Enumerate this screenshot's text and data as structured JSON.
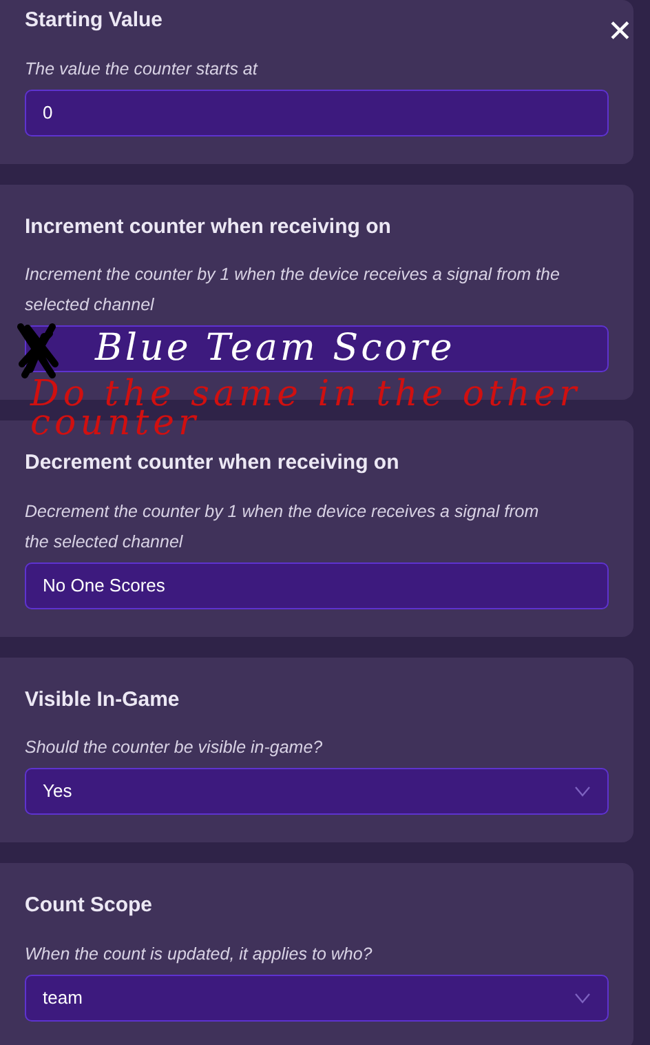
{
  "close_button": {
    "label": "✕"
  },
  "sections": [
    {
      "title": "Starting Value",
      "description": "The value the counter starts at",
      "field": {
        "kind": "text",
        "value": "0"
      }
    },
    {
      "title": "Increment counter when receiving on",
      "description": "Increment the counter by 1 when the device receives a signal from the selected channel",
      "field": {
        "kind": "text"
      },
      "annotation": {
        "text": "Blue Team Score",
        "color": "#ffffff"
      }
    },
    {
      "title": "Decrement counter when receiving on",
      "description": "Decrement the counter by 1 when the device receives a signal from the selected channel",
      "field": {
        "kind": "text",
        "value": "No One Scores"
      }
    },
    {
      "title": "Visible In-Game",
      "description": "Should the counter be visible in-game?",
      "field": {
        "kind": "dropdown",
        "value": "Yes"
      }
    },
    {
      "title": "Count Scope",
      "description": "When the count is updated, it applies to who?",
      "field": {
        "kind": "dropdown",
        "value": "team"
      }
    }
  ],
  "note": {
    "text": "Do the same in the other counter",
    "color": "#d01010"
  }
}
